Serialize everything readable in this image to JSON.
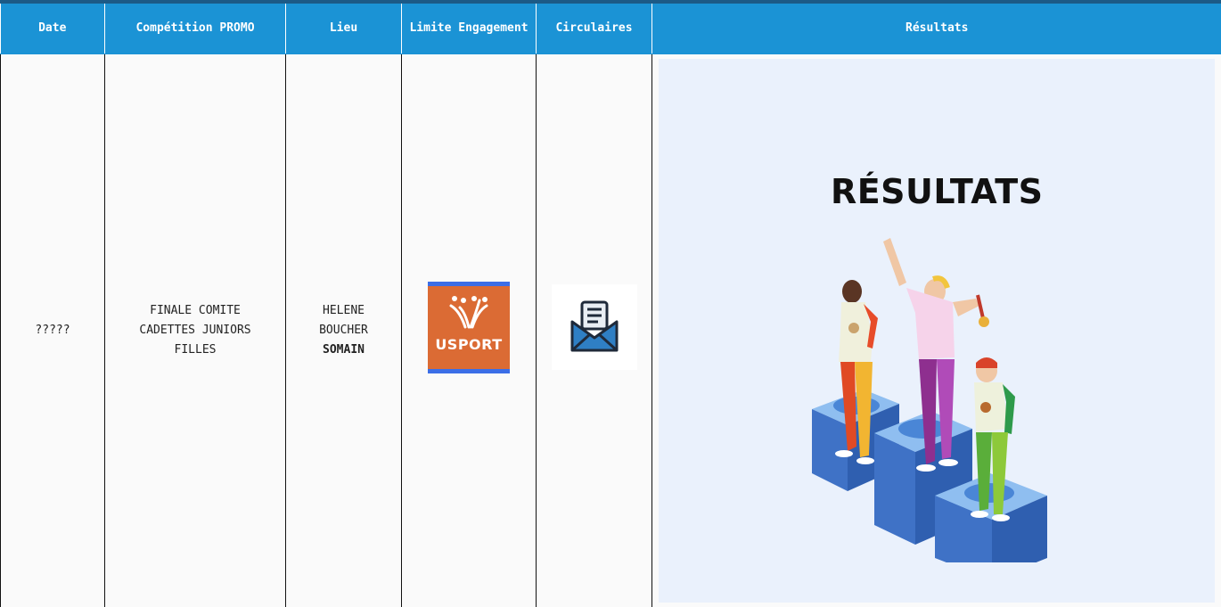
{
  "table": {
    "headers": {
      "date": "Date",
      "competition": "Compétition PROMO",
      "lieu": "Lieu",
      "limite": "Limite Engagement",
      "circulaires": "Circulaires",
      "resultats": "Résultats"
    },
    "row": {
      "date": "?????",
      "competition_line1": "FINALE COMITE",
      "competition_line2": "CADETTES JUNIORS",
      "competition_line3": "FILLES",
      "lieu_line1": "HELENE",
      "lieu_line2": "BOUCHER",
      "lieu_line3": "SOMAIN",
      "limite_logo_text": "USPORT",
      "limite_logo_icon": "usport-logo-icon",
      "circulaire_icon": "mail-envelope-icon",
      "resultats_title": "RÉSULTATS",
      "resultats_image": "podium-athletes-illustration"
    }
  },
  "colors": {
    "header_bg": "#1b93d5",
    "top_border": "#1c5a86",
    "usport_orange": "#db6b34",
    "usport_blue": "#3b6ee7",
    "results_panel_bg": "#eaf1fc",
    "podium_blue": "#3f72c6"
  }
}
